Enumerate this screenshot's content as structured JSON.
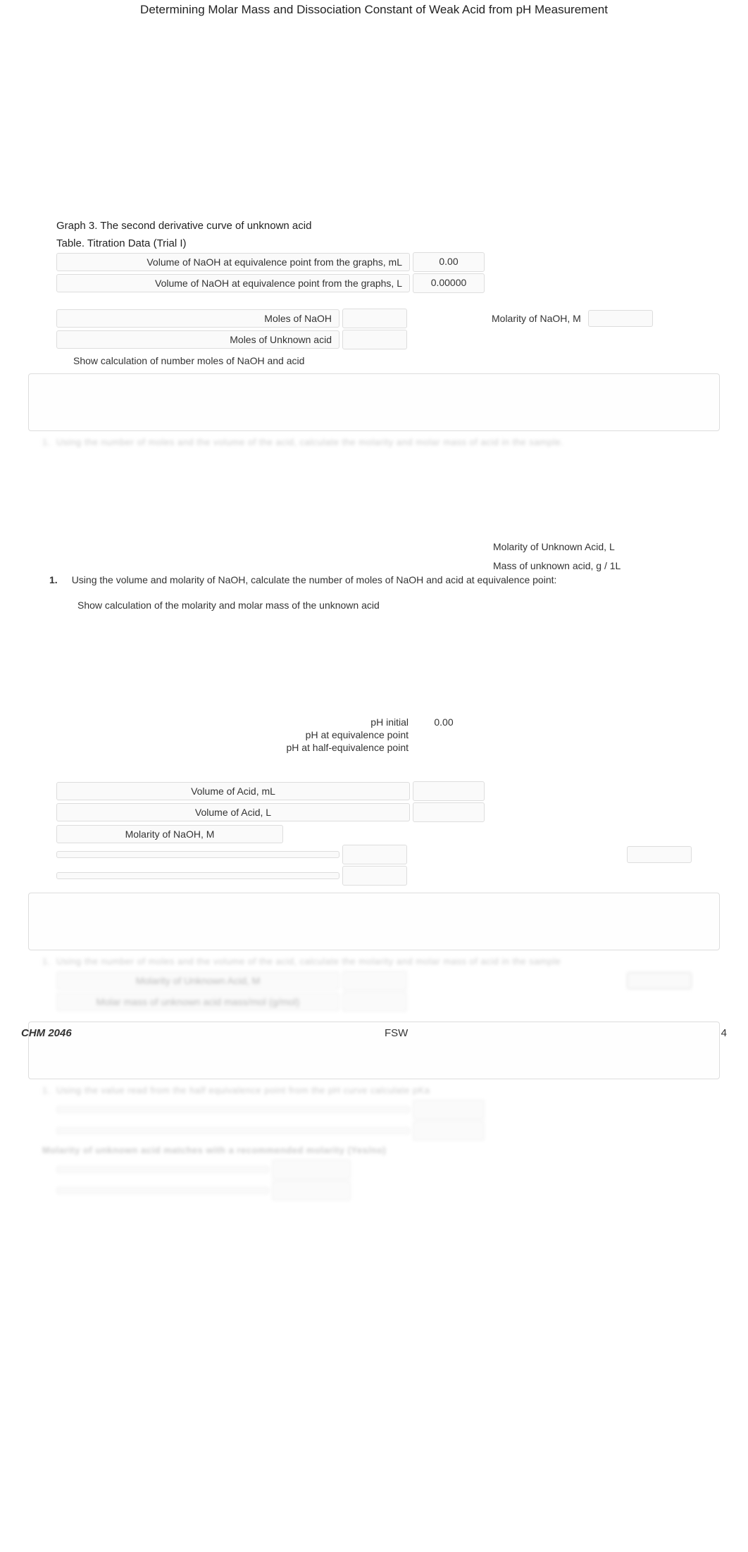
{
  "title": "Determining Molar Mass and Dissociation Constant of Weak Acid from pH Measurement",
  "graph3_caption": "Graph 3. The second derivative curve of unknown acid",
  "table_title": "Table. Titration Data (Trial I)",
  "rows": {
    "vol_naoh_ml_label": "Volume of NaOH at equivalence point from the graphs, mL",
    "vol_naoh_ml_value": "0.00",
    "vol_naoh_l_label": "Volume of NaOH at equivalence point from the graphs, L",
    "vol_naoh_l_value": "0.00000",
    "moles_naoh_label": "Moles of NaOH",
    "moles_unknown_label": "Moles of  Unknown acid",
    "molarity_naoh_label": "Molarity of NaOH, M"
  },
  "instruction1": "Show calculation of number moles of NaOH and acid",
  "blur1": "Using the number of moles and the volume of the acid, calculate the molarity and molar mass of acid in the sample.",
  "q1": {
    "num": "1.",
    "text": "Using the volume and molarity of NaOH, calculate the number of moles of NaOH and acid at equivalence point:",
    "overlap": "Molarity of Unknown Acid, L",
    "mass_label": "Mass of unknown acid, g / 1L"
  },
  "instruction2": "Show calculation of the molarity and molar mass of the unknown acid",
  "ph": {
    "initial_label": "pH initial",
    "initial_value": "0.00",
    "equiv_label": "pH at equivalence point",
    "half_equiv_label": "pH at half-equivalence point"
  },
  "lower": {
    "vol_acid_ml": "Volume of Acid, mL",
    "vol_acid_l": "Volume of Acid, L",
    "molarity_naoh": "Molarity of NaOH, M"
  },
  "blur2": "Using the number of moles and the volume of the acid, calculate the molarity and molar mass of acid in the sample",
  "blur_row1": "Molarity of Unknown Acid, M",
  "blur_row2": "Molar mass of unknown acid mass/mol (g/mol)",
  "blur3": "Using the value read from the half equivalence point from the pH curve calculate pKa",
  "blur4": "Molarity of unknown acid matches with a recommended molarity (Yes/no)",
  "footer": {
    "left": "CHM 2046",
    "center": "FSW",
    "right": "4"
  }
}
